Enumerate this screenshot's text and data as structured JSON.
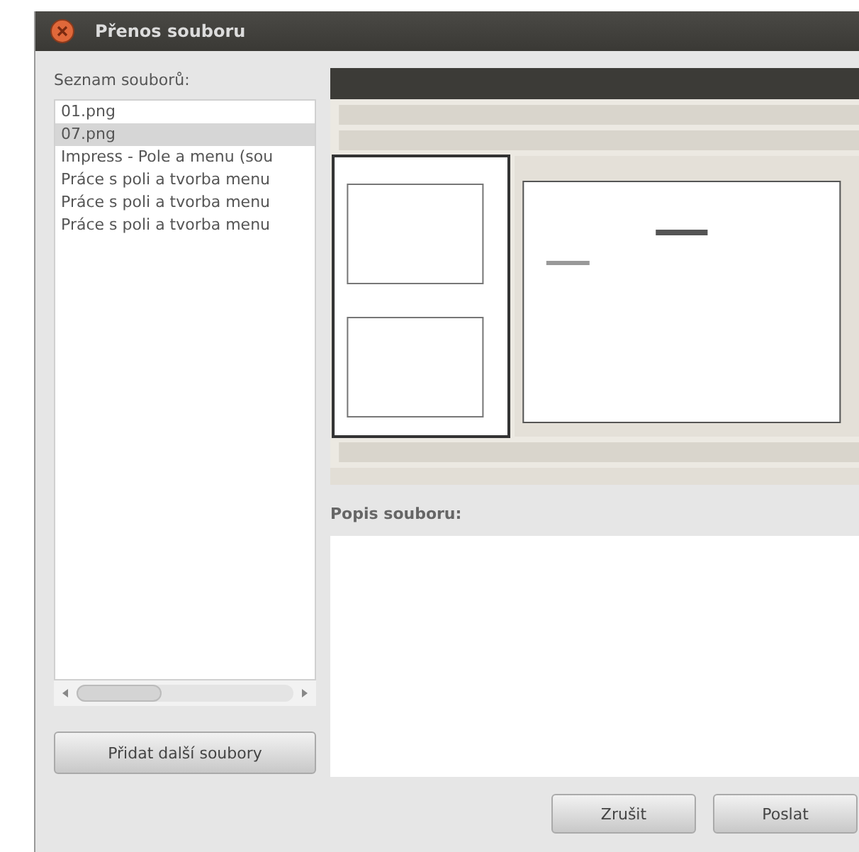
{
  "window": {
    "title": "Přenos souboru"
  },
  "file_list": {
    "label": "Seznam souborů:",
    "items": [
      {
        "name": "01.png",
        "selected": false
      },
      {
        "name": "07.png",
        "selected": true
      },
      {
        "name": "Impress - Pole a menu (sou",
        "selected": false
      },
      {
        "name": "Práce s poli a tvorba menu",
        "selected": false
      },
      {
        "name": "Práce s poli a tvorba menu",
        "selected": false
      },
      {
        "name": "Práce s poli a tvorba menu",
        "selected": false
      }
    ]
  },
  "add_button": "Přidat další soubory",
  "description": {
    "label": "Popis souboru:"
  },
  "buttons": [
    "Zrušit",
    "Poslat"
  ]
}
